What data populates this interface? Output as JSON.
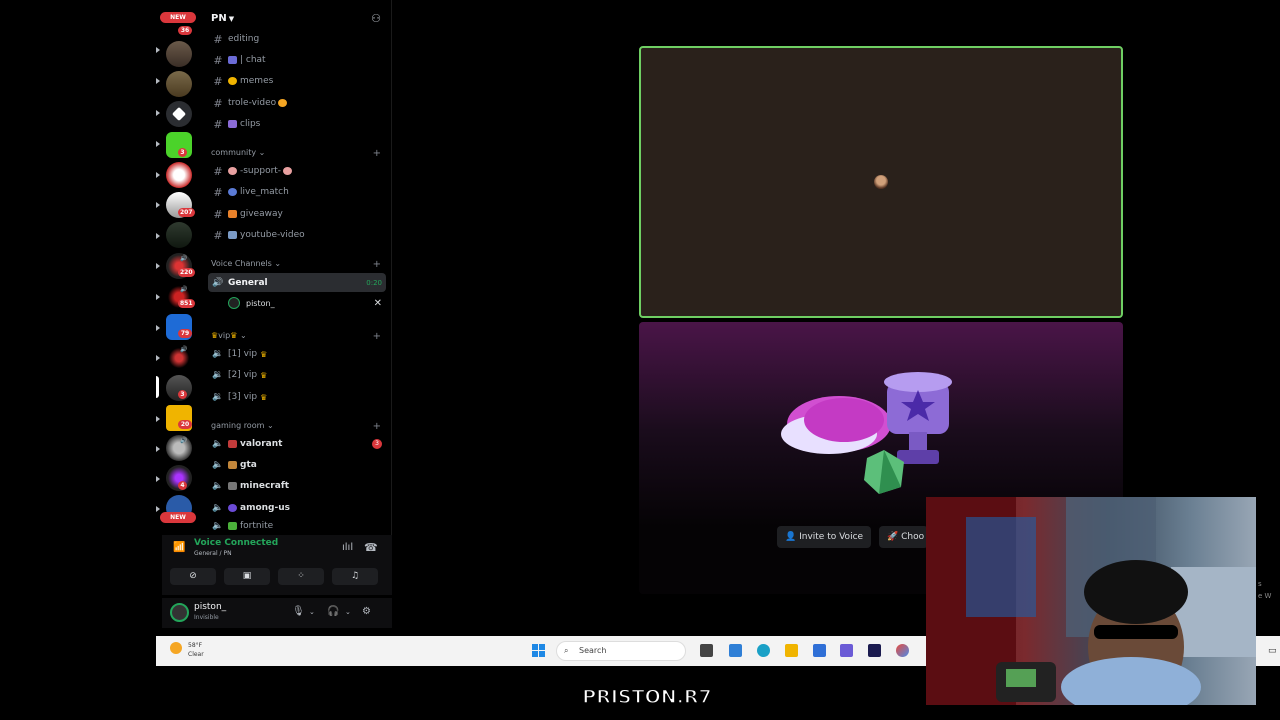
{
  "rail": {
    "new_top": "NEW",
    "new_bottom": "NEW",
    "badges": [
      "36",
      "3",
      "207",
      "220",
      "851",
      "79",
      "3",
      "20",
      "4"
    ],
    "servers": [
      "server-1",
      "server-2",
      "server-3",
      "server-4",
      "server-5",
      "server-6",
      "server-7",
      "server-8",
      "server-9",
      "server-10",
      "server-11",
      "server-12",
      "server-13",
      "server-14",
      "server-15",
      "server-16",
      "server-17"
    ]
  },
  "server": {
    "name": "PN"
  },
  "channels": {
    "top": [
      {
        "name": "editing"
      },
      {
        "name": "| chat"
      },
      {
        "name": "memes"
      },
      {
        "name": "trole-video"
      },
      {
        "name": "clips"
      }
    ],
    "community_label": "community",
    "community": [
      {
        "name": "-support-"
      },
      {
        "name": "live_match"
      },
      {
        "name": "giveaway"
      },
      {
        "name": "youtube-video"
      }
    ],
    "voice_label": "Voice Channels",
    "general": {
      "name": "General",
      "timer": "0:20"
    },
    "member": {
      "name": "piston_"
    },
    "vip_label": "vip",
    "vip": [
      {
        "name": "[1] vip"
      },
      {
        "name": "[2] vip"
      },
      {
        "name": "[3] vip"
      }
    ],
    "gaming_label": "gaming room",
    "gaming": [
      {
        "name": "valorant",
        "badge": "3"
      },
      {
        "name": "gta"
      },
      {
        "name": "minecraft"
      },
      {
        "name": "among-us"
      },
      {
        "name": "fortnite"
      }
    ]
  },
  "voice_panel": {
    "status": "Voice Connected",
    "location": "General / PN"
  },
  "user_panel": {
    "username": "piston_",
    "status": "Invisible"
  },
  "stage": {
    "invite_label": "Invite to Voice",
    "choose_label": "Choo"
  },
  "taskbar": {
    "temp": "58°F",
    "weather": "Clear",
    "search_placeholder": "Search"
  },
  "watermark": "PRISTON.R7",
  "edge_text": [
    "s",
    "e W"
  ],
  "colors": {
    "accent_green": "#23a55a",
    "badge_red": "#da373c",
    "tile_border": "#6fcf63"
  }
}
